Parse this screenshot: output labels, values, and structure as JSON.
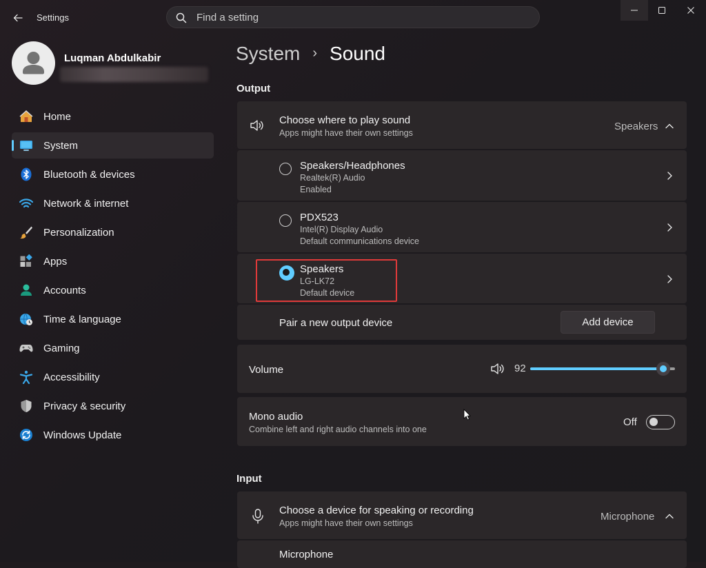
{
  "app": {
    "title": "Settings"
  },
  "search": {
    "placeholder": "Find a setting"
  },
  "user": {
    "name": "Luqman Abdulkabir"
  },
  "sidebar": {
    "items": [
      {
        "label": "Home",
        "icon": "home-icon"
      },
      {
        "label": "System",
        "icon": "system-icon",
        "active": true
      },
      {
        "label": "Bluetooth & devices",
        "icon": "bluetooth-icon"
      },
      {
        "label": "Network & internet",
        "icon": "wifi-icon"
      },
      {
        "label": "Personalization",
        "icon": "brush-icon"
      },
      {
        "label": "Apps",
        "icon": "apps-icon"
      },
      {
        "label": "Accounts",
        "icon": "accounts-icon"
      },
      {
        "label": "Time & language",
        "icon": "globe-clock-icon"
      },
      {
        "label": "Gaming",
        "icon": "gamepad-icon"
      },
      {
        "label": "Accessibility",
        "icon": "accessibility-icon"
      },
      {
        "label": "Privacy & security",
        "icon": "shield-icon"
      },
      {
        "label": "Windows Update",
        "icon": "update-icon"
      }
    ]
  },
  "breadcrumb": {
    "parent": "System",
    "separator": "›",
    "current": "Sound"
  },
  "output": {
    "section_title": "Output",
    "choose": {
      "title": "Choose where to play sound",
      "subtitle": "Apps might have their own settings",
      "value": "Speakers"
    },
    "devices": [
      {
        "name": "Speakers/Headphones",
        "line1": "Realtek(R) Audio",
        "line2": "Enabled",
        "selected": false
      },
      {
        "name": "PDX523",
        "line1": "Intel(R) Display Audio",
        "line2": "Default communications device",
        "selected": false
      },
      {
        "name": "Speakers",
        "line1": "LG-LK72",
        "line2": "Default device",
        "selected": true
      }
    ],
    "pair": {
      "label": "Pair a new output device",
      "button": "Add device"
    },
    "volume": {
      "label": "Volume",
      "value": "92",
      "level": 0.92
    },
    "mono": {
      "title": "Mono audio",
      "subtitle": "Combine left and right audio channels into one",
      "state": "Off"
    }
  },
  "input": {
    "section_title": "Input",
    "choose": {
      "title": "Choose a device for speaking or recording",
      "subtitle": "Apps might have their own settings",
      "value": "Microphone"
    },
    "first_device": "Microphone"
  },
  "colors": {
    "accent": "#60cdff",
    "highlight": "#e03a3a",
    "card": "#2b2729",
    "background": "#1f1b1e"
  }
}
